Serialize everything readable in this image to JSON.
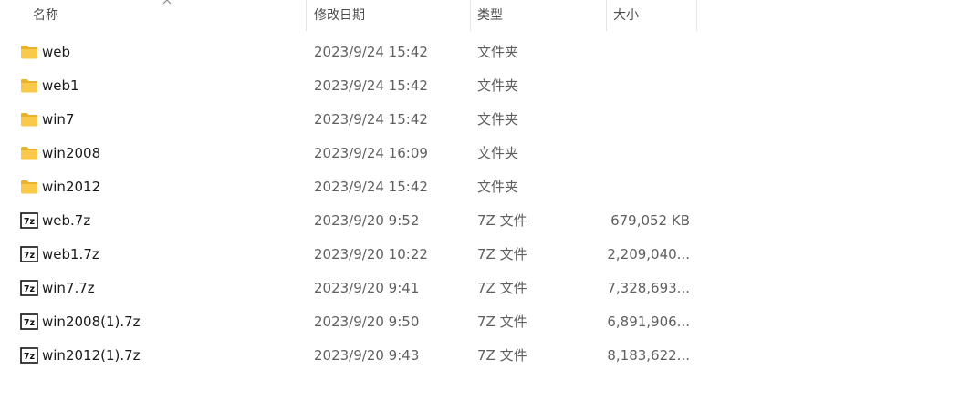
{
  "columns": {
    "name": "名称",
    "date": "修改日期",
    "type": "类型",
    "size": "大小"
  },
  "sort": {
    "column": "name",
    "direction": "ascending",
    "icon": "chevron-up-icon"
  },
  "colors": {
    "folder": "#f8c94a",
    "folder_dark": "#e8b22c",
    "text_primary": "#1a1a1a",
    "text_secondary": "#5f5f5f",
    "header_text": "#4c4c4c",
    "separator": "#e5e5e5"
  },
  "files": [
    {
      "name": "web",
      "date": "2023/9/24 15:42",
      "type": "文件夹",
      "size": "",
      "icon": "folder-icon"
    },
    {
      "name": "web1",
      "date": "2023/9/24 15:42",
      "type": "文件夹",
      "size": "",
      "icon": "folder-icon"
    },
    {
      "name": "win7",
      "date": "2023/9/24 15:42",
      "type": "文件夹",
      "size": "",
      "icon": "folder-icon"
    },
    {
      "name": "win2008",
      "date": "2023/9/24 16:09",
      "type": "文件夹",
      "size": "",
      "icon": "folder-icon"
    },
    {
      "name": "win2012",
      "date": "2023/9/24 15:42",
      "type": "文件夹",
      "size": "",
      "icon": "folder-icon"
    },
    {
      "name": "web.7z",
      "date": "2023/9/20 9:52",
      "type": "7Z 文件",
      "size": "679,052 KB",
      "icon": "7z-archive-icon"
    },
    {
      "name": "web1.7z",
      "date": "2023/9/20 10:22",
      "type": "7Z 文件",
      "size": "2,209,040...",
      "icon": "7z-archive-icon"
    },
    {
      "name": "win7.7z",
      "date": "2023/9/20 9:41",
      "type": "7Z 文件",
      "size": "7,328,693...",
      "icon": "7z-archive-icon"
    },
    {
      "name": "win2008(1).7z",
      "date": "2023/9/20 9:50",
      "type": "7Z 文件",
      "size": "6,891,906...",
      "icon": "7z-archive-icon"
    },
    {
      "name": "win2012(1).7z",
      "date": "2023/9/20 9:43",
      "type": "7Z 文件",
      "size": "8,183,622...",
      "icon": "7z-archive-icon"
    }
  ]
}
